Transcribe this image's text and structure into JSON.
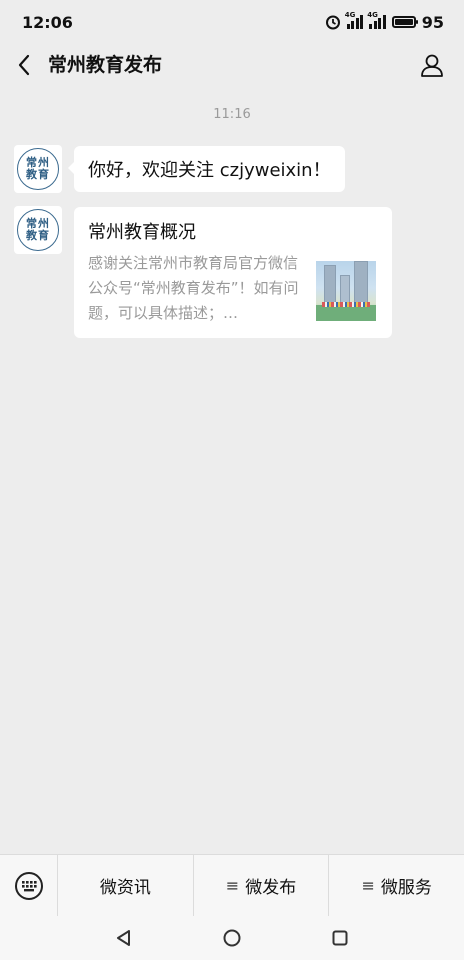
{
  "status_bar": {
    "time": "12:06",
    "signal1_label": "4G",
    "signal2_label": "4G",
    "battery": "95"
  },
  "header": {
    "title": "常州教育发布"
  },
  "chat": {
    "timestamp": "11:16",
    "avatar_text_line1": "常州",
    "avatar_text_line2": "教育",
    "greeting": "你好，欢迎关注 czjyweixin！",
    "article": {
      "title": "常州教育概况",
      "description": "感谢关注常州市教育局官方微信公众号“常州教育发布”！如有问题，可以具体描述；…"
    }
  },
  "bottom_menu": {
    "items": [
      {
        "label": "微资讯",
        "glyph": ""
      },
      {
        "label": "微发布",
        "glyph": "≡"
      },
      {
        "label": "微服务",
        "glyph": "≡"
      }
    ]
  }
}
